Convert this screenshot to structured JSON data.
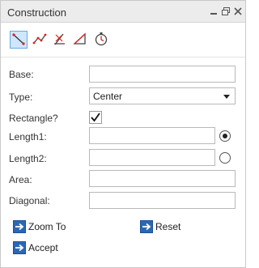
{
  "window": {
    "title": "Construction"
  },
  "toolbar": {
    "tools": [
      {
        "icon": "point-on-segment-icon",
        "active": true
      },
      {
        "icon": "polyline-curve-icon",
        "active": false
      },
      {
        "icon": "intersection-angle-icon",
        "active": false
      },
      {
        "icon": "right-triangle-icon",
        "active": false
      },
      {
        "icon": "clock-timer-icon",
        "active": false
      }
    ]
  },
  "form": {
    "base_label": "Base:",
    "base_value": "",
    "type_label": "Type:",
    "type_value": "Center",
    "rectangle_label": "Rectangle?",
    "rectangle_checked": true,
    "length1_label": "Length1:",
    "length1_value": "",
    "length2_label": "Length2:",
    "length2_value": "",
    "area_label": "Area:",
    "area_value": "",
    "diagonal_label": "Diagonal:",
    "diagonal_value": ""
  },
  "actions": {
    "zoom_to": "Zoom To",
    "reset": "Reset",
    "accept": "Accept"
  },
  "colors": {
    "accent": "#2c67b4",
    "active_tool_bg": "#cfe6fb",
    "red_mark": "#d22"
  }
}
